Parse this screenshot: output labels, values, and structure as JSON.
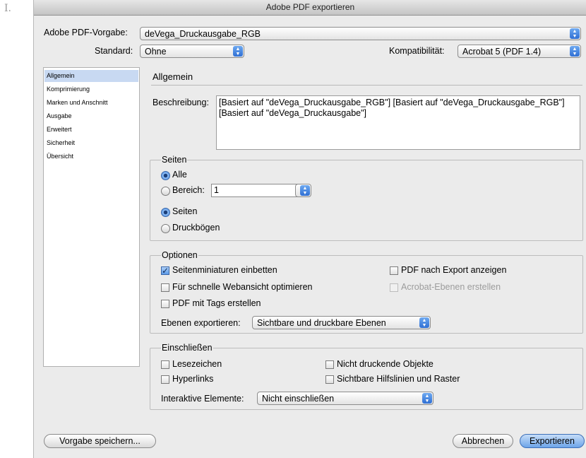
{
  "outer_label": "I.",
  "window": {
    "title": "Adobe PDF exportieren"
  },
  "top": {
    "preset_label": "Adobe PDF-Vorgabe:",
    "preset_value": "deVega_Druckausgabe_RGB",
    "standard_label": "Standard:",
    "standard_value": "Ohne",
    "compat_label": "Kompatibilität:",
    "compat_value": "Acrobat 5 (PDF 1.4)"
  },
  "sidebar": {
    "items": [
      {
        "label": "Allgemein",
        "selected": true
      },
      {
        "label": "Komprimierung"
      },
      {
        "label": "Marken und Anschnitt"
      },
      {
        "label": "Ausgabe"
      },
      {
        "label": "Erweitert"
      },
      {
        "label": "Sicherheit"
      },
      {
        "label": "Übersicht"
      }
    ]
  },
  "main": {
    "title": "Allgemein",
    "description_label": "Beschreibung:",
    "description_text": "[Basiert auf \"deVega_Druckausgabe_RGB\"] [Basiert auf \"deVega_Druckausgabe_RGB\"] [Basiert auf \"deVega_Druckausgabe\"]"
  },
  "pages": {
    "legend": "Seiten",
    "all_label": "Alle",
    "all_selected": true,
    "range_label": "Bereich:",
    "range_value": "1",
    "pages_label": "Seiten",
    "pages_selected": true,
    "spreads_label": "Druckbögen"
  },
  "options": {
    "legend": "Optionen",
    "embed_thumbnails": "Seitenminiaturen einbetten",
    "embed_thumbnails_checked": true,
    "web_optimize": "Für schnelle Webansicht optimieren",
    "tagged_pdf": "PDF mit Tags erstellen",
    "view_after_export": "PDF nach Export anzeigen",
    "acrobat_layers": "Acrobat-Ebenen erstellen",
    "acrobat_layers_disabled": true,
    "export_layers_label": "Ebenen exportieren:",
    "export_layers_value": "Sichtbare und druckbare Ebenen"
  },
  "include": {
    "legend": "Einschließen",
    "bookmarks": "Lesezeichen",
    "hyperlinks": "Hyperlinks",
    "non_printing": "Nicht druckende Objekte",
    "guides": "Sichtbare Hilfslinien und Raster",
    "interactive_label": "Interaktive Elemente:",
    "interactive_value": "Nicht einschließen"
  },
  "buttons": {
    "save_preset": "Vorgabe speichern...",
    "cancel": "Abbrechen",
    "export": "Exportieren"
  },
  "colors": {
    "accent": "#3f82e0",
    "selection": "#c8d9f2",
    "dialog_bg": "#ebebeb"
  }
}
